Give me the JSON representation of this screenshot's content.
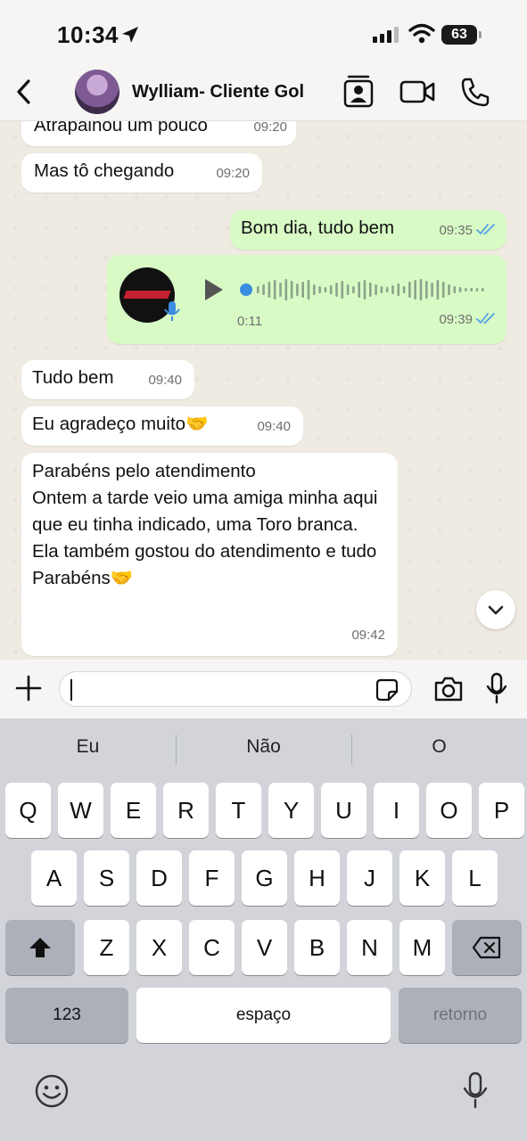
{
  "status_bar": {
    "time": "10:34",
    "battery": "63"
  },
  "header": {
    "contact_name": "Wylliam- Cliente Gol"
  },
  "messages": [
    {
      "dir": "in",
      "text": "Atrapalhou um pouco",
      "time": "09:20"
    },
    {
      "dir": "in",
      "text": "Mas tô chegando",
      "time": "09:20"
    },
    {
      "dir": "out",
      "text": "Bom dia, tudo bem",
      "time": "09:35",
      "status": "read"
    },
    {
      "dir": "out",
      "type": "voice",
      "duration": "0:11",
      "time": "09:39",
      "status": "read"
    },
    {
      "dir": "in",
      "text": "Tudo bem",
      "time": "09:40"
    },
    {
      "dir": "in",
      "text": "Eu agradeço muito🤝",
      "time": "09:40"
    },
    {
      "dir": "in",
      "text": "Parabéns pelo atendimento\nOntem a tarde veio uma amiga minha aqui que eu tinha indicado, uma Toro branca.\nEla também gostou do atendimento e tudo\nParabéns🤝",
      "time": "09:42"
    }
  ],
  "composer": {
    "value": ""
  },
  "keyboard": {
    "suggestions": [
      "Eu",
      "Não",
      "O"
    ],
    "row1": [
      "Q",
      "W",
      "E",
      "R",
      "T",
      "Y",
      "U",
      "I",
      "O",
      "P"
    ],
    "row2": [
      "A",
      "S",
      "D",
      "F",
      "G",
      "H",
      "J",
      "K",
      "L"
    ],
    "row3": [
      "Z",
      "X",
      "C",
      "V",
      "B",
      "N",
      "M"
    ],
    "numbers_label": "123",
    "space_label": "espaço",
    "return_label": "retorno"
  },
  "colors": {
    "outgoing_bubble": "#d8fbc6",
    "incoming_bubble": "#ffffff",
    "read_ticks": "#4fa3e6"
  },
  "icons": [
    "location-arrow-icon",
    "cellular-signal-icon",
    "wifi-icon",
    "battery-icon",
    "back-chevron-icon",
    "contact-card-icon",
    "video-call-icon",
    "phone-call-icon",
    "play-icon",
    "mic-badge-icon",
    "read-ticks-icon",
    "chevron-down-icon",
    "plus-icon",
    "sticker-icon",
    "camera-icon",
    "mic-icon",
    "shift-icon",
    "backspace-icon",
    "emoji-icon",
    "dictation-icon"
  ]
}
